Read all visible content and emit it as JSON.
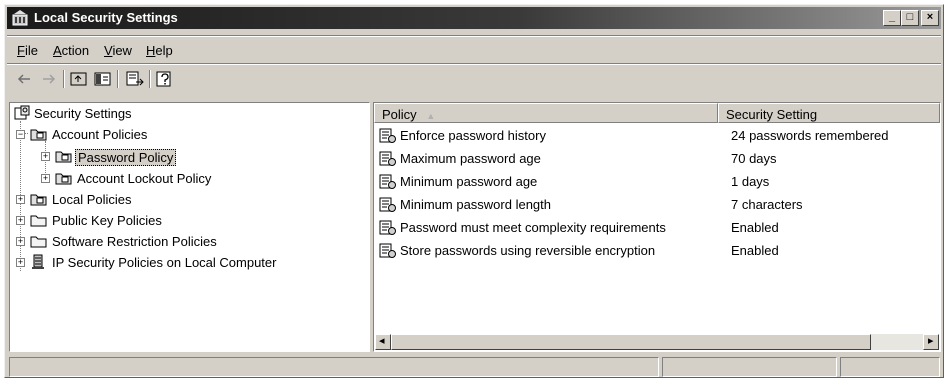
{
  "window": {
    "title": "Local Security Settings",
    "controls": {
      "minimize": "_",
      "maximize": "□",
      "close": "×"
    }
  },
  "menu": {
    "items": [
      {
        "label": "File",
        "accel": "F",
        "rest": "ile"
      },
      {
        "label": "Action",
        "accel": "A",
        "rest": "ction"
      },
      {
        "label": "View",
        "accel": "V",
        "rest": "iew"
      },
      {
        "label": "Help",
        "accel": "H",
        "rest": "elp"
      }
    ]
  },
  "toolbar": {
    "buttons": [
      "back-icon",
      "forward-icon",
      "up-one-level-icon",
      "show-hide-console-tree-icon",
      "export-list-icon",
      "help-icon"
    ]
  },
  "tree": {
    "root": "Security Settings",
    "account_policies": "Account Policies",
    "password_policy": "Password Policy",
    "account_lockout_policy": "Account Lockout Policy",
    "local_policies": "Local Policies",
    "public_key_policies": "Public Key Policies",
    "software_restriction_policies": "Software Restriction Policies",
    "ip_security_policies": "IP Security Policies on Local Computer",
    "expander_minus": "−",
    "expander_plus": "+"
  },
  "list": {
    "columns": {
      "policy": "Policy",
      "setting": "Security Setting",
      "sort_indicator": "▲"
    },
    "rows": [
      {
        "policy": "Enforce password history",
        "setting": "24 passwords remembered"
      },
      {
        "policy": "Maximum password age",
        "setting": "70 days"
      },
      {
        "policy": "Minimum password age",
        "setting": "1 days"
      },
      {
        "policy": "Minimum password length",
        "setting": "7 characters"
      },
      {
        "policy": "Password must meet complexity requirements",
        "setting": "Enabled"
      },
      {
        "policy": "Store passwords using reversible encryption",
        "setting": "Enabled"
      }
    ]
  },
  "scrollbar": {
    "left_arrow": "◂",
    "right_arrow": "▸"
  },
  "colors": {
    "face": "#d4d0c8",
    "titlebar_start": "#1a1a1a",
    "titlebar_end": "#9a9a9a",
    "pane_background": "#ffffff"
  }
}
